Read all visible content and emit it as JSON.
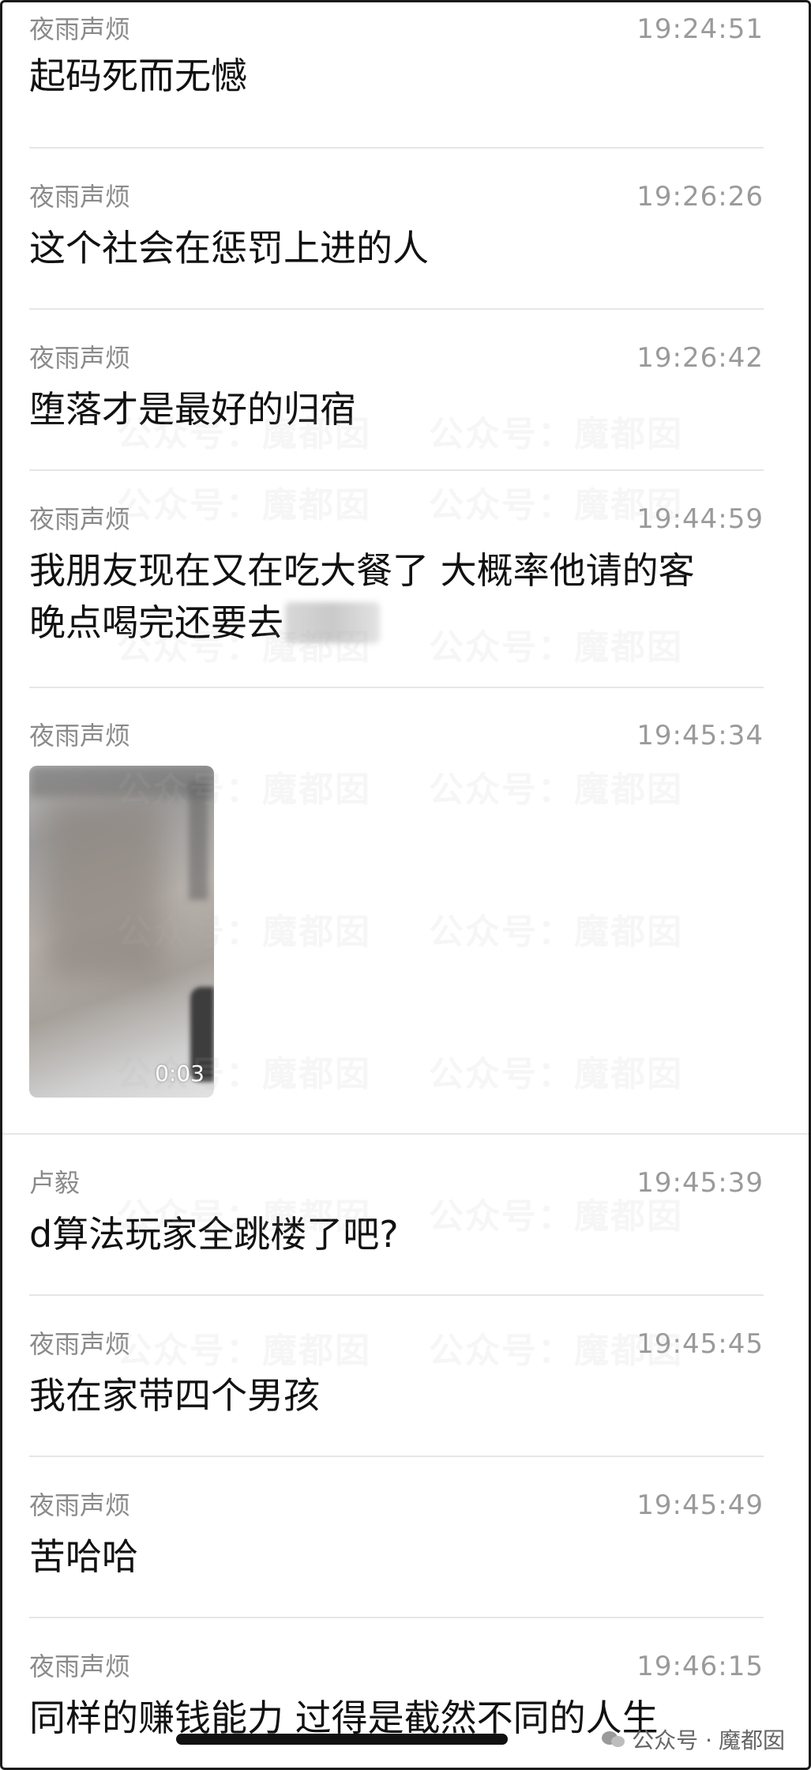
{
  "messages": [
    {
      "sender": "夜雨声烦",
      "time": "19:24:51",
      "lines": [
        "起码死而无憾"
      ]
    },
    {
      "sender": "夜雨声烦",
      "time": "19:26:26",
      "lines": [
        "这个社会在惩罚上进的人"
      ]
    },
    {
      "sender": "夜雨声烦",
      "time": "19:26:42",
      "lines": [
        "堕落才是最好的归宿"
      ]
    },
    {
      "sender": "夜雨声烦",
      "time": "19:44:59",
      "lines": [
        "我朋友现在又在吃大餐了 大概率他请的客",
        "晚点喝完还要去"
      ]
    },
    {
      "sender": "夜雨声烦",
      "time": "19:45:34",
      "video_duration": "0:03"
    },
    {
      "sender": "卢毅",
      "time": "19:45:39",
      "lines": [
        "d算法玩家全跳楼了吧?"
      ]
    },
    {
      "sender": "夜雨声烦",
      "time": "19:45:45",
      "lines": [
        "我在家带四个男孩"
      ]
    },
    {
      "sender": "夜雨声烦",
      "time": "19:45:49",
      "lines": [
        "苦哈哈"
      ]
    },
    {
      "sender": "夜雨声烦",
      "time": "19:46:15",
      "lines": [
        "同样的赚钱能力 过得是截然不同的人生"
      ]
    }
  ],
  "watermark": {
    "text": "公众号：魔都囡"
  },
  "brand": {
    "prefix": "公众号 ·",
    "name": "魔都囡",
    "icon": "wechat-icon"
  }
}
